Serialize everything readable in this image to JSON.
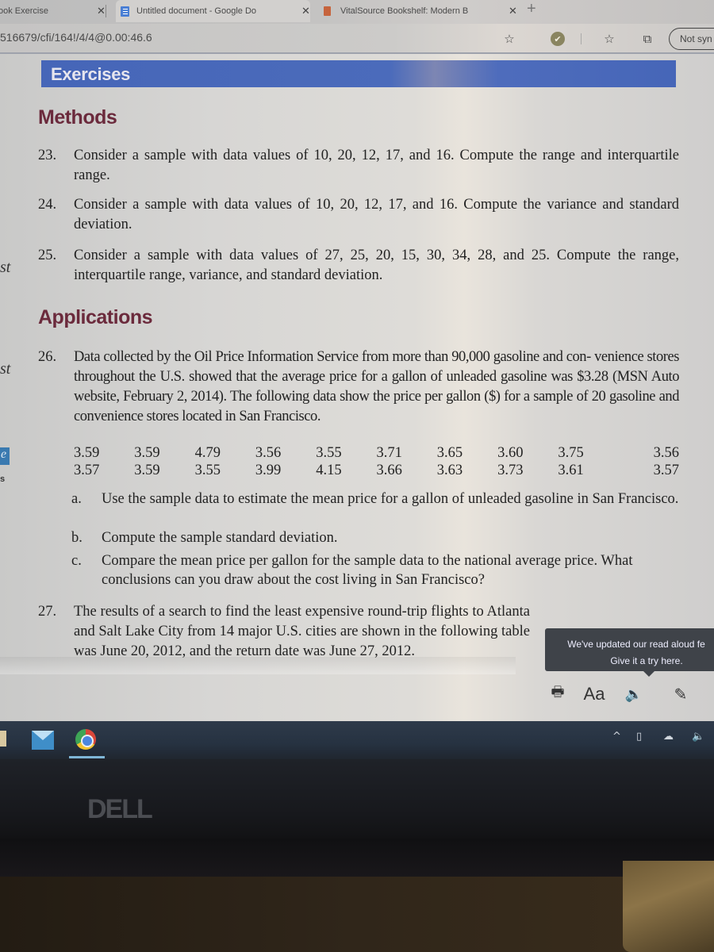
{
  "browser": {
    "tabs": [
      {
        "label": "ook Exercise",
        "close": "✕"
      },
      {
        "label": "Untitled document - Google Do",
        "close": "✕"
      },
      {
        "label": "VitalSource Bookshelf: Modern B",
        "close": "✕"
      }
    ],
    "new_tab": "+",
    "url": "516679/cfi/164!/4/4@0.00:46.6",
    "toolbar": {
      "add_favorite_icon": "☆",
      "check_icon": "✔",
      "favorites_icon": "☆",
      "collections_icon": "⧉",
      "sync_label": "Not syn"
    }
  },
  "sidebar": {
    "fragments": [
      "st",
      "st",
      "e",
      "s"
    ]
  },
  "book": {
    "banner": "Exercises",
    "methods_heading": "Methods",
    "applications_heading": "Applications",
    "exercises": [
      {
        "num": "23.",
        "text": "Consider a sample with data values of 10, 20, 12, 17, and 16. Compute the range and interquartile range."
      },
      {
        "num": "24.",
        "text": "Consider a sample with data values of 10, 20, 12, 17, and 16. Compute the variance and standard deviation."
      },
      {
        "num": "25.",
        "text": "Consider a sample with data values of 27, 25, 20, 15, 30, 34, 28, and 25. Compute the range, interquartile range, variance, and standard deviation."
      },
      {
        "num": "26.",
        "text": "Data collected by the Oil Price Information Service from more than 90,000 gasoline and con- venience stores throughout the U.S. showed that the average price for a gallon of unleaded gasoline was $3.28 (MSN Auto website, February 2, 2014). The following data show the price per gallon ($) for a sample of 20 gasoline and convenience stores located in San Francisco."
      },
      {
        "num": "27.",
        "text": "The results of a search to find the least expensive round-trip flights to Atlanta and Salt Lake City from 14 major U.S. cities are shown in the following table was June 20, 2012, and the return date was June 27, 2012."
      }
    ],
    "gas_prices": [
      [
        "3.59",
        "3.59",
        "4.79",
        "3.56",
        "3.55",
        "3.71",
        "3.65",
        "3.60",
        "3.75",
        "3.56"
      ],
      [
        "3.57",
        "3.59",
        "3.55",
        "3.99",
        "4.15",
        "3.66",
        "3.63",
        "3.73",
        "3.61",
        "3.57"
      ]
    ],
    "subparts": [
      {
        "letter": "a.",
        "text": "Use the sample data to estimate the mean price for a gallon of unleaded gasoline in San Francisco."
      },
      {
        "letter": "b.",
        "text": "Compute the sample standard deviation."
      },
      {
        "letter": "c.",
        "text": "Compare the mean price per gallon for the sample data to the national average price. What conclusions can you draw about the cost living in San Francisco?"
      }
    ]
  },
  "tooltip": {
    "line1": "We've updated our read aloud fe",
    "line2": "Give it a try here."
  },
  "reader_tools": {
    "print_icon": "🖶",
    "text_size_label": "Aa",
    "read_aloud_icon": "🔈",
    "highlight_icon": "✎"
  },
  "taskbar": {
    "tray": {
      "chevron": "^",
      "meet_icon": "▯",
      "cloud_icon": "☁",
      "volume_icon": "🔈"
    }
  },
  "monitor": {
    "brand": "DELL"
  }
}
